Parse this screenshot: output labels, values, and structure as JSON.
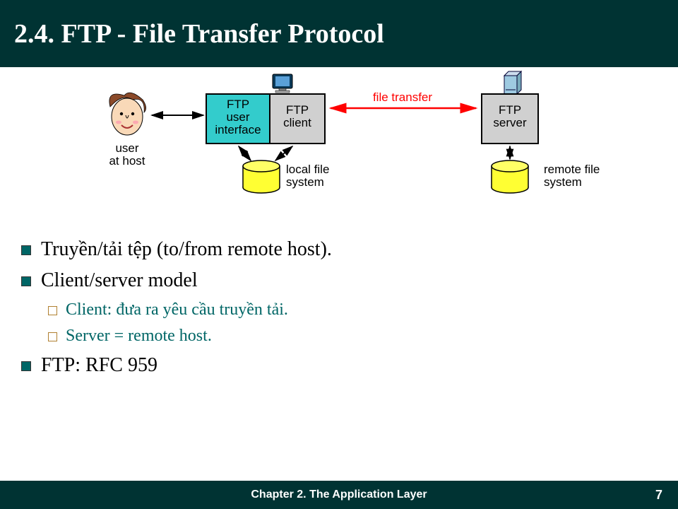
{
  "header": {
    "title": "2.4. FTP - File Transfer Protocol"
  },
  "diagram": {
    "user_label": "user\nat host",
    "ftp_ui": "FTP\nuser\ninterface",
    "ftp_client": "FTP\nclient",
    "ftp_server": "FTP\nserver",
    "file_transfer": "file transfer",
    "local_fs": "local file\nsystem",
    "remote_fs": "remote file\nsystem"
  },
  "bullets": [
    {
      "level": 1,
      "text": "Truyền/tải tệp (to/from remote host)."
    },
    {
      "level": 1,
      "text": "Client/server model"
    },
    {
      "level": 2,
      "text": "Client: đưa ra yêu cầu truyền tải."
    },
    {
      "level": 2,
      "text": "Server = remote host."
    },
    {
      "level": 1,
      "text": "FTP: RFC 959"
    }
  ],
  "footer": {
    "chapter": "Chapter 2. The Application Layer",
    "page": "7"
  }
}
